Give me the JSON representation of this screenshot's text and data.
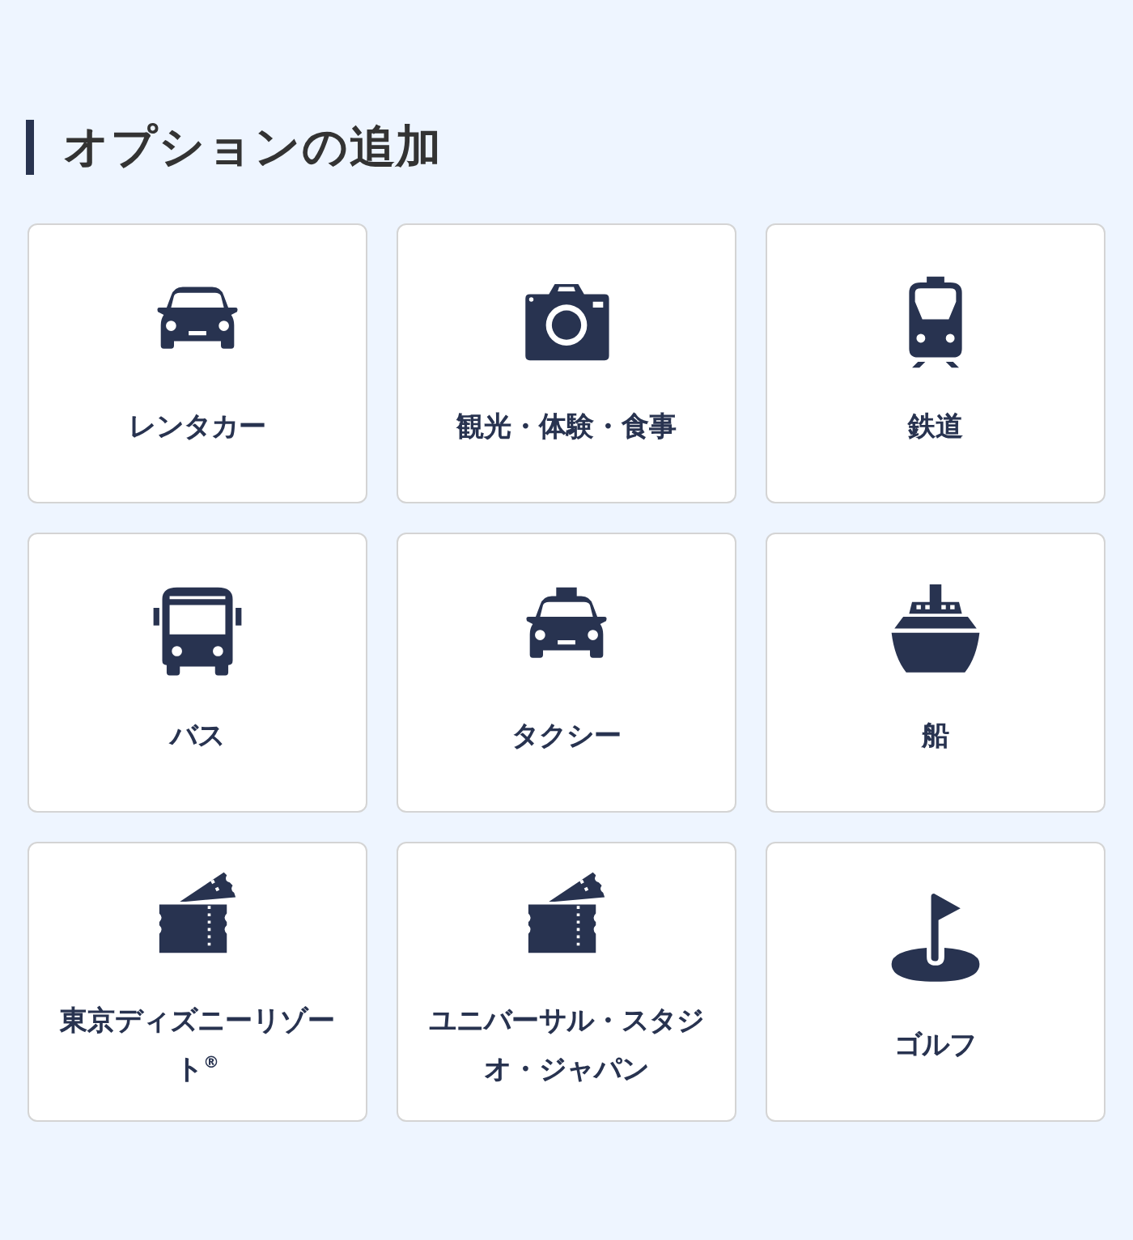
{
  "section": {
    "title": "オプションの追加"
  },
  "options": [
    {
      "label": "レンタカー",
      "kind": "car"
    },
    {
      "label": "観光・体験・食事",
      "kind": "camera"
    },
    {
      "label": "鉄道",
      "kind": "train"
    },
    {
      "label": "バス",
      "kind": "bus"
    },
    {
      "label": "タクシー",
      "kind": "taxi"
    },
    {
      "label": "船",
      "kind": "ship"
    },
    {
      "label": "東京ディズニーリゾート$^{®}$",
      "kind": "ticket"
    },
    {
      "label": "ユニバーサル・スタジオ・ジャパン",
      "kind": "ticket"
    },
    {
      "label": "ゴルフ",
      "kind": "golf"
    }
  ]
}
